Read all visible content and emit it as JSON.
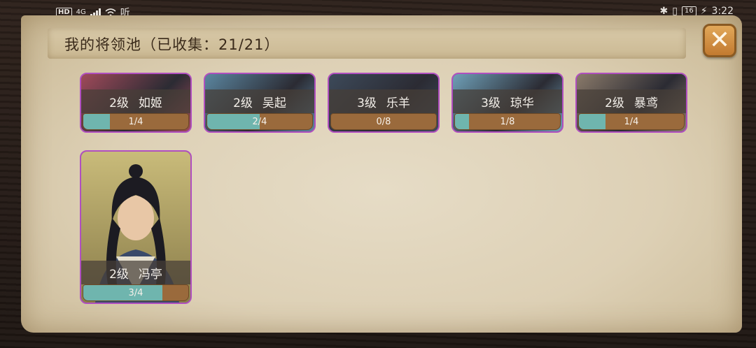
{
  "status_bar": {
    "hd": "HD",
    "network": "4G",
    "extra": "听",
    "battery": "16",
    "time": "3:22"
  },
  "header": {
    "title": "我的将领池（已收集：21/21）"
  },
  "close_icon": "close-icon",
  "colors": {
    "card_border": "#b04fc0",
    "progress_fill": "#6fb5ae",
    "progress_track": "#9a6a3c"
  },
  "cards": [
    {
      "level": "2级",
      "name": "如姬",
      "progress": "1/4",
      "fraction": 0.25,
      "tone": "#a04a5a"
    },
    {
      "level": "2级",
      "name": "吴起",
      "progress": "2/4",
      "fraction": 0.5,
      "tone": "#5b86a0"
    },
    {
      "level": "3级",
      "name": "乐羊",
      "progress": "0/8",
      "fraction": 0.0,
      "tone": "#3d4a5a"
    },
    {
      "level": "3级",
      "name": "琼华",
      "progress": "1/8",
      "fraction": 0.125,
      "tone": "#6fa0b8"
    },
    {
      "level": "2级",
      "name": "暴鸢",
      "progress": "1/4",
      "fraction": 0.25,
      "tone": "#8a7a6a"
    },
    {
      "level": "2级",
      "name": "冯亭",
      "progress": "3/4",
      "fraction": 0.75,
      "tone": "#7a7350"
    }
  ]
}
